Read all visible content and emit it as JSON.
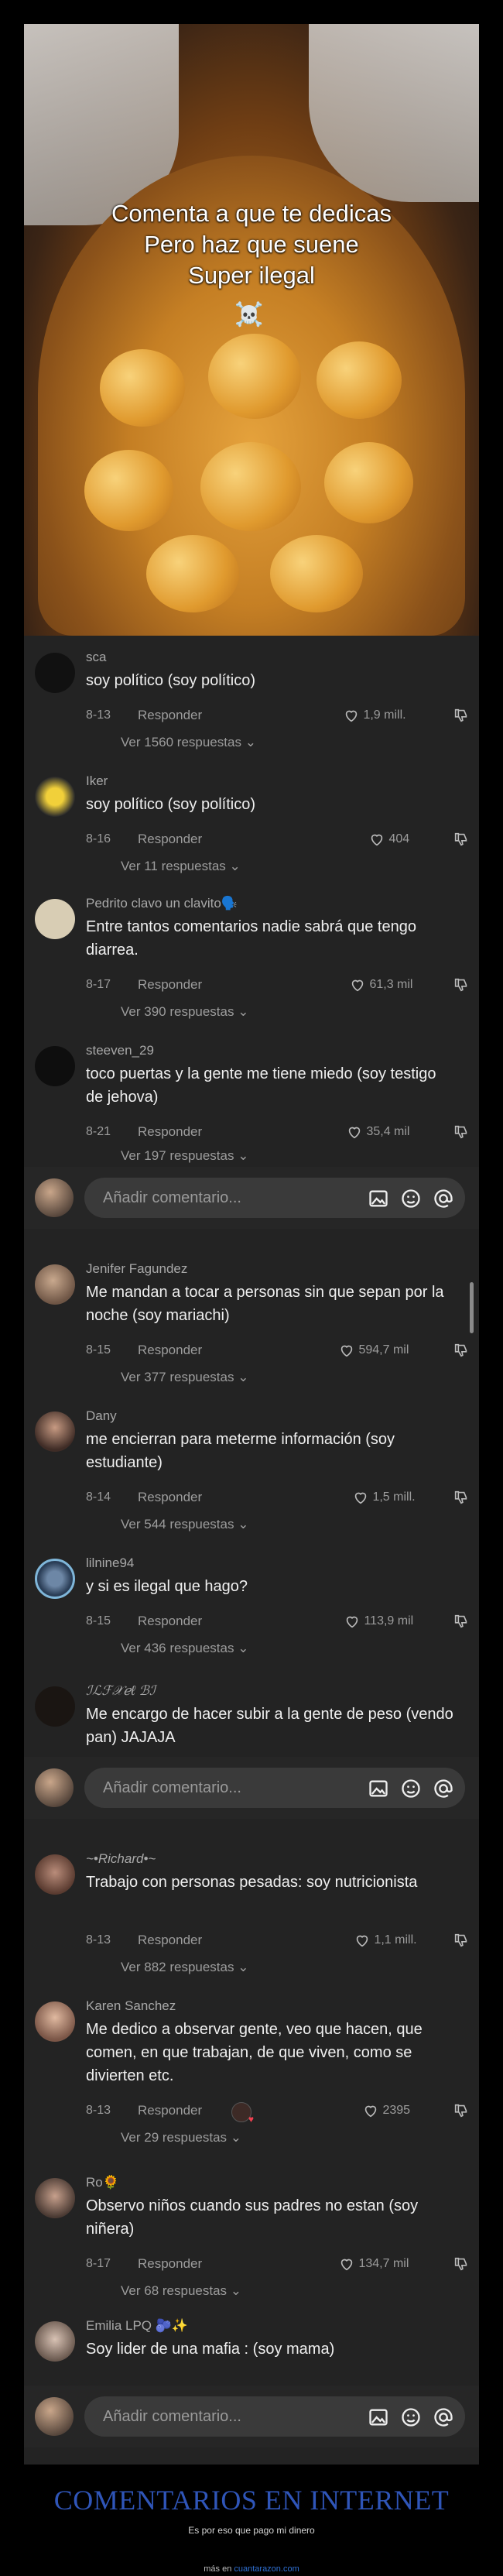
{
  "video": {
    "caption_lines": [
      "Comenta a que te dedicas",
      "Pero haz que suene",
      "Super ilegal"
    ],
    "caption_emoji": "☠️"
  },
  "comments": [
    {
      "user": "sca",
      "text": "soy político (soy político)",
      "date": "8-13",
      "reply": "Responder",
      "likes": "1,9 mill.",
      "more": "Ver 1560 respuestas"
    },
    {
      "user": "Iker",
      "text": "soy político (soy político)",
      "date": "8-16",
      "reply": "Responder",
      "likes": "404",
      "more": "Ver 11 respuestas"
    },
    {
      "user": "Pedrito clavo un clavito🗣️",
      "text": "Entre tantos comentarios nadie sabrá que tengo diarrea.",
      "date": "8-17",
      "reply": "Responder",
      "likes": "61,3 mil",
      "more": "Ver 390 respuestas"
    },
    {
      "user": "steeven_29",
      "text": "toco puertas y la gente me tiene miedo (soy testigo de jehova)",
      "date": "8-21",
      "reply": "Responder",
      "likes": "35,4 mil",
      "more": "Ver 197 respuestas"
    },
    {
      "user": "Jenifer Fagundez",
      "text": "Me mandan a tocar a personas sin que sepan por la noche (soy mariachi)",
      "date": "8-15",
      "reply": "Responder",
      "likes": "594,7 mil",
      "more": "Ver 377 respuestas"
    },
    {
      "user": "Dany",
      "text": "me encierran para meterme información (soy estudiante)",
      "date": "8-14",
      "reply": "Responder",
      "likes": "1,5 mill.",
      "more": "Ver 544 respuestas"
    },
    {
      "user": "lilnine94",
      "text": "y si es ilegal que hago?",
      "date": "8-15",
      "reply": "Responder",
      "likes": "113,9 mil",
      "more": "Ver 436 respuestas"
    },
    {
      "user": "ℐℒℱ𝒳ℯℓ ℬℐ",
      "text": "Me encargo de hacer subir a la gente de peso (vendo pan) JAJAJA",
      "date": "",
      "reply": "",
      "likes": "",
      "more": ""
    },
    {
      "user": "~•Richard•~",
      "text": "Trabajo con personas pesadas: soy nutricionista",
      "date": "8-13",
      "reply": "Responder",
      "likes": "1,1 mill.",
      "more": "Ver 882 respuestas"
    },
    {
      "user": "Karen Sanchez",
      "text": "Me dedico a observar gente, veo que hacen, que comen, en que trabajan, de que viven, como se divierten etc.",
      "date": "8-13",
      "reply": "Responder",
      "likes": "2395",
      "more": "Ver 29 respuestas"
    },
    {
      "user": "Ro🌻",
      "text": "Observo niños cuando sus padres no estan (soy niñera)",
      "date": "8-17",
      "reply": "Responder",
      "likes": "134,7 mil",
      "more": "Ver 68 respuestas"
    },
    {
      "user": "Emilia LPQ 🫐✨",
      "text": "Soy lider de una mafia : (soy mama)",
      "date": "",
      "reply": "",
      "likes": "",
      "more": ""
    }
  ],
  "input_bar": {
    "placeholder": "Añadir comentario..."
  },
  "icons": [
    "image-icon",
    "emoji-icon",
    "mention-icon",
    "heart-icon",
    "dislike-icon",
    "chevron-down-icon"
  ],
  "footer": {
    "title": "COMENTARIOS EN INTERNET",
    "subtitle": "Es por eso que pago mi dinero",
    "credit_prefix": "más en",
    "credit_site": "cuantarazon.com"
  },
  "colors": {
    "background": "#232323",
    "footer_title": "#2f55b8",
    "link": "#2f6fd1"
  }
}
